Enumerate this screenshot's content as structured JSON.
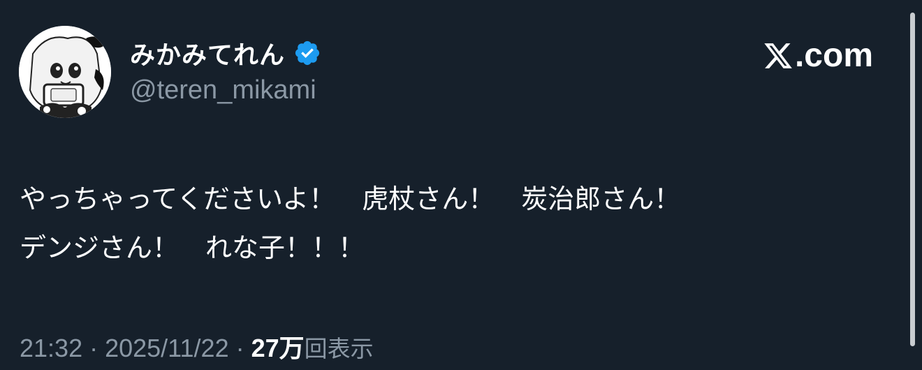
{
  "post": {
    "author": {
      "display_name": "みかみてれん",
      "handle": "@teren_mikami",
      "verified_icon": "verified-badge-icon",
      "avatar_icon": "avatar-illustration"
    },
    "brand": "X.com",
    "brand_suffix": ".com",
    "text_lines": [
      "やっちゃってくださいよ！　虎杖さん！　炭治郎さん！",
      "デンジさん！　れな子！！！"
    ],
    "time": "21:32",
    "separator": " · ",
    "date": "2025/11/22",
    "views_count": "27万",
    "views_label": "回表示"
  },
  "colors": {
    "background": "#15202b",
    "text_primary": "#ffffff",
    "text_secondary": "#8b98a5",
    "verified": "#1d9bf0"
  }
}
